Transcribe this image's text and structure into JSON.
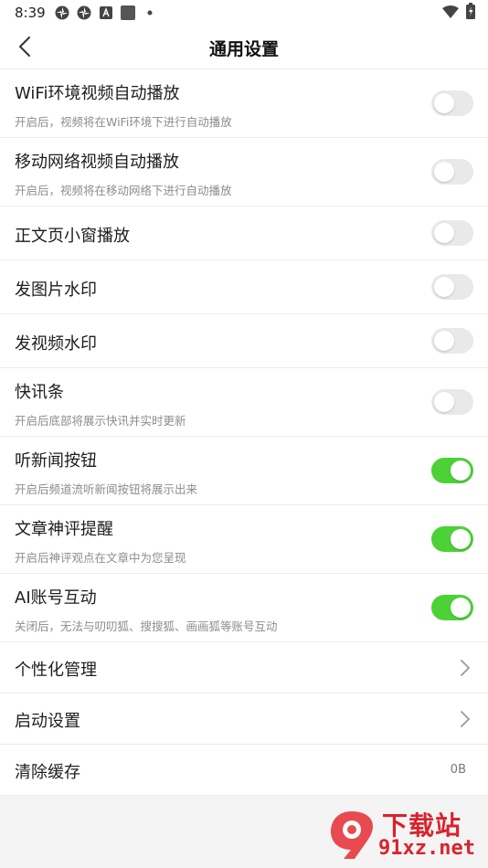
{
  "status_bar": {
    "time": "8:39",
    "left_icons": [
      "pinwheel-icon",
      "pinwheel-icon",
      "font-a-icon",
      "square-icon",
      "dot-icon"
    ],
    "right_icons": [
      "wifi-icon",
      "battery-charging-icon"
    ]
  },
  "header": {
    "title": "通用设置",
    "back_icon": "chevron-left-icon"
  },
  "settings": {
    "wifi_autoplay": {
      "title": "WiFi环境视频自动播放",
      "desc": "开启后，视频将在WiFi环境下进行自动播放",
      "enabled": false
    },
    "mobile_autoplay": {
      "title": "移动网络视频自动播放",
      "desc": "开启后，视频将在移动网络下进行自动播放",
      "enabled": false
    },
    "article_mini_window": {
      "title": "正文页小窗播放",
      "enabled": false
    },
    "image_watermark": {
      "title": "发图片水印",
      "enabled": false
    },
    "video_watermark": {
      "title": "发视频水印",
      "enabled": false
    },
    "news_flash_bar": {
      "title": "快讯条",
      "desc": "开启后底部将展示快讯并实时更新",
      "enabled": false
    },
    "listen_news_button": {
      "title": "听新闻按钮",
      "desc": "开启后频道流听新闻按钮将展示出来",
      "enabled": true
    },
    "comment_reminder": {
      "title": "文章神评提醒",
      "desc": "开启后神评观点在文章中为您呈现",
      "enabled": true
    },
    "ai_account_interaction": {
      "title": "AI账号互动",
      "desc": "关闭后，无法与叨叨狐、搜搜狐、画画狐等账号互动",
      "enabled": true
    },
    "personalization": {
      "title": "个性化管理"
    },
    "startup_settings": {
      "title": "启动设置"
    },
    "clear_cache": {
      "title": "清除缓存",
      "value": "0B"
    }
  },
  "watermark": {
    "line1": "下载站",
    "line2": "91xz.net",
    "badge": "9"
  },
  "colors": {
    "toggle_on": "#4cd137",
    "toggle_off": "#e9e9e9",
    "watermark": "#d9232d"
  }
}
